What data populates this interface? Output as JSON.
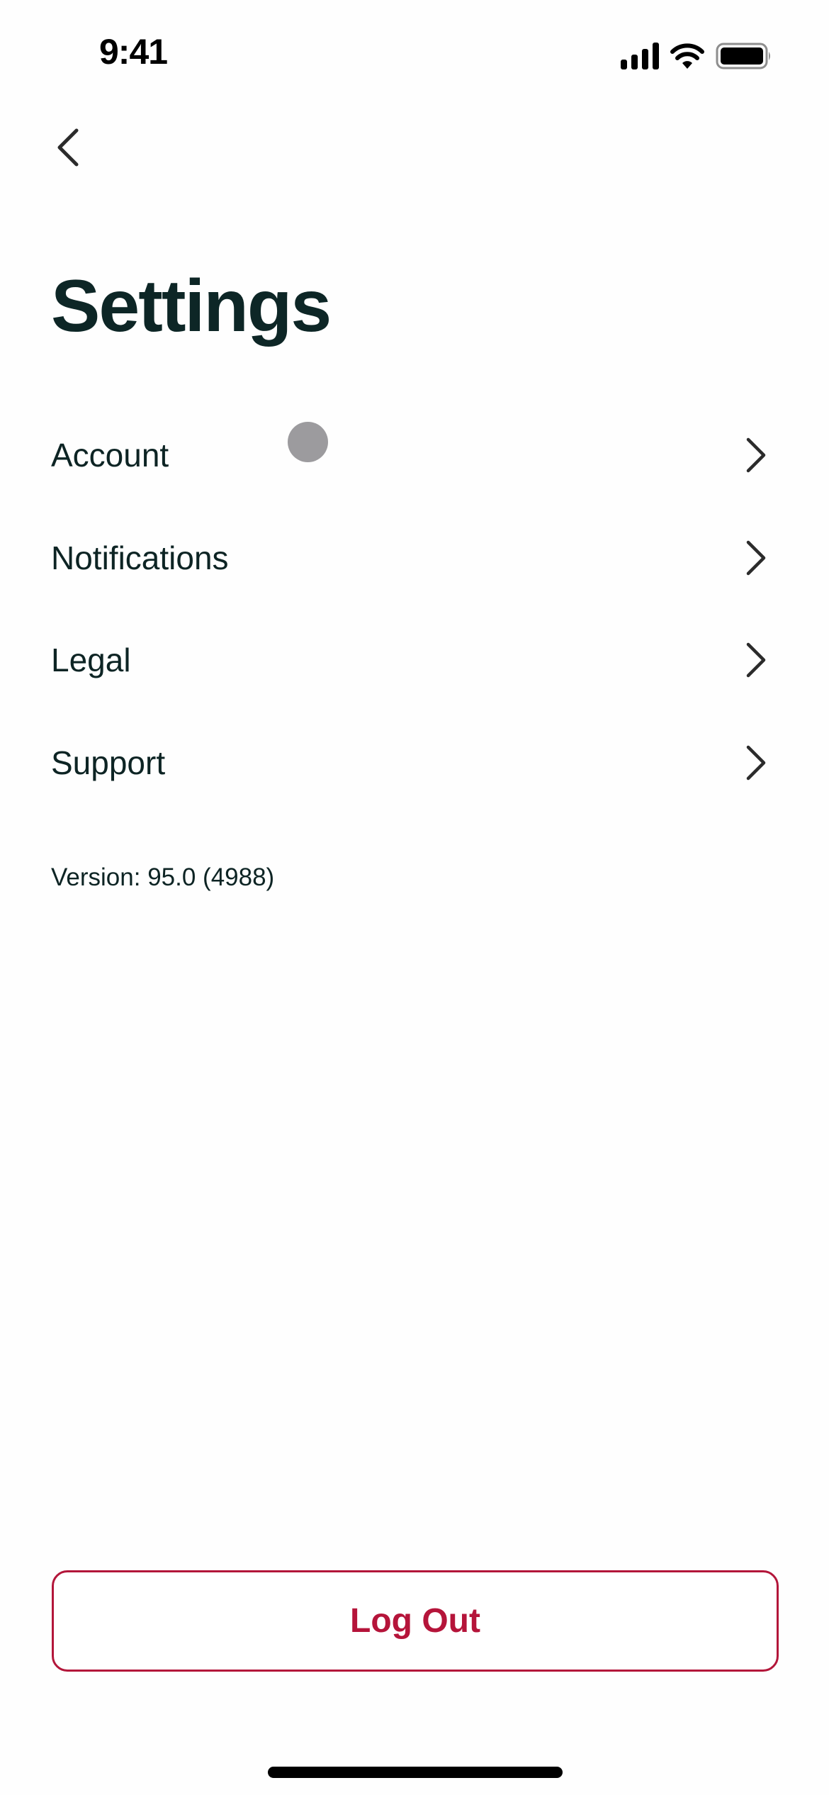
{
  "status_bar": {
    "time": "9:41",
    "icons": [
      "signal-icon",
      "wifi-icon",
      "battery-icon"
    ]
  },
  "nav": {
    "back_icon": "chevron-left-icon"
  },
  "page": {
    "title": "Settings"
  },
  "menu": {
    "items": [
      {
        "label": "Account",
        "icon": "chevron-right-icon"
      },
      {
        "label": "Notifications",
        "icon": "chevron-right-icon"
      },
      {
        "label": "Legal",
        "icon": "chevron-right-icon"
      },
      {
        "label": "Support",
        "icon": "chevron-right-icon"
      }
    ]
  },
  "version_text": "Version: 95.0 (4988)",
  "logout": {
    "label": "Log Out",
    "color": "#b5143a"
  },
  "colors": {
    "text": "#0d2424",
    "accent": "#b5143a",
    "background": "#fefefe"
  }
}
